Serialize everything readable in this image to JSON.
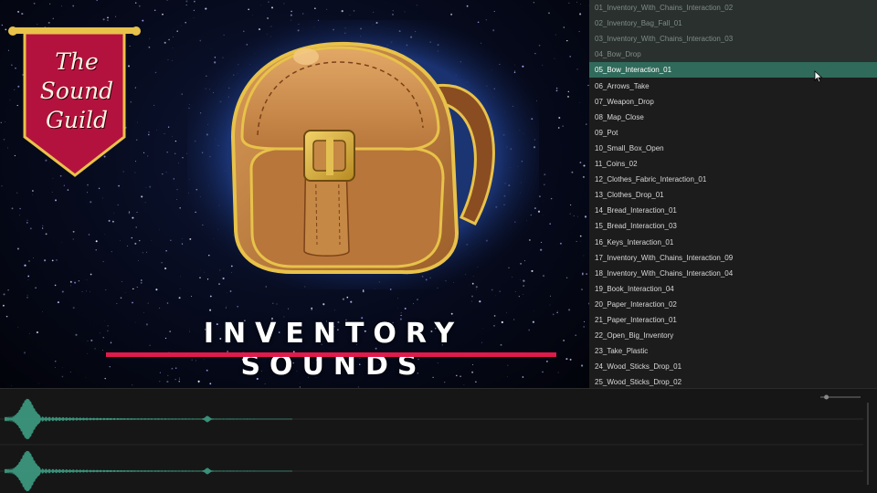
{
  "artwork": {
    "banner_lines": [
      "The",
      "Sound",
      "Guild"
    ],
    "title": "INVENTORY SOUNDS",
    "accent_color": "#e11a4c",
    "banner_color": "#b3123f",
    "bag_color": "#c98a48"
  },
  "playlist": {
    "selected_index": 4,
    "items": [
      "01_Inventory_With_Chains_Interaction_02",
      "02_Inventory_Bag_Fall_01",
      "03_Inventory_With_Chains_Interaction_03",
      "04_Bow_Drop",
      "05_Bow_Interaction_01",
      "06_Arrows_Take",
      "07_Weapon_Drop",
      "08_Map_Close",
      "09_Pot",
      "10_Small_Box_Open",
      "11_Coins_02",
      "12_Clothes_Fabric_Interaction_01",
      "13_Clothes_Drop_01",
      "14_Bread_Interaction_01",
      "15_Bread_Interaction_03",
      "16_Keys_Interaction_01",
      "17_Inventory_With_Chains_Interaction_09",
      "18_Inventory_With_Chains_Interaction_04",
      "19_Book_Interaction_04",
      "20_Paper_Interaction_02",
      "21_Paper_Interaction_01",
      "22_Open_Big_Inventory",
      "23_Take_Plastic",
      "24_Wood_Sticks_Drop_01",
      "25_Wood_Sticks_Drop_02"
    ]
  },
  "waveform": {
    "wave_color": "#3fa589",
    "channels": 2,
    "volume": 0.85
  }
}
